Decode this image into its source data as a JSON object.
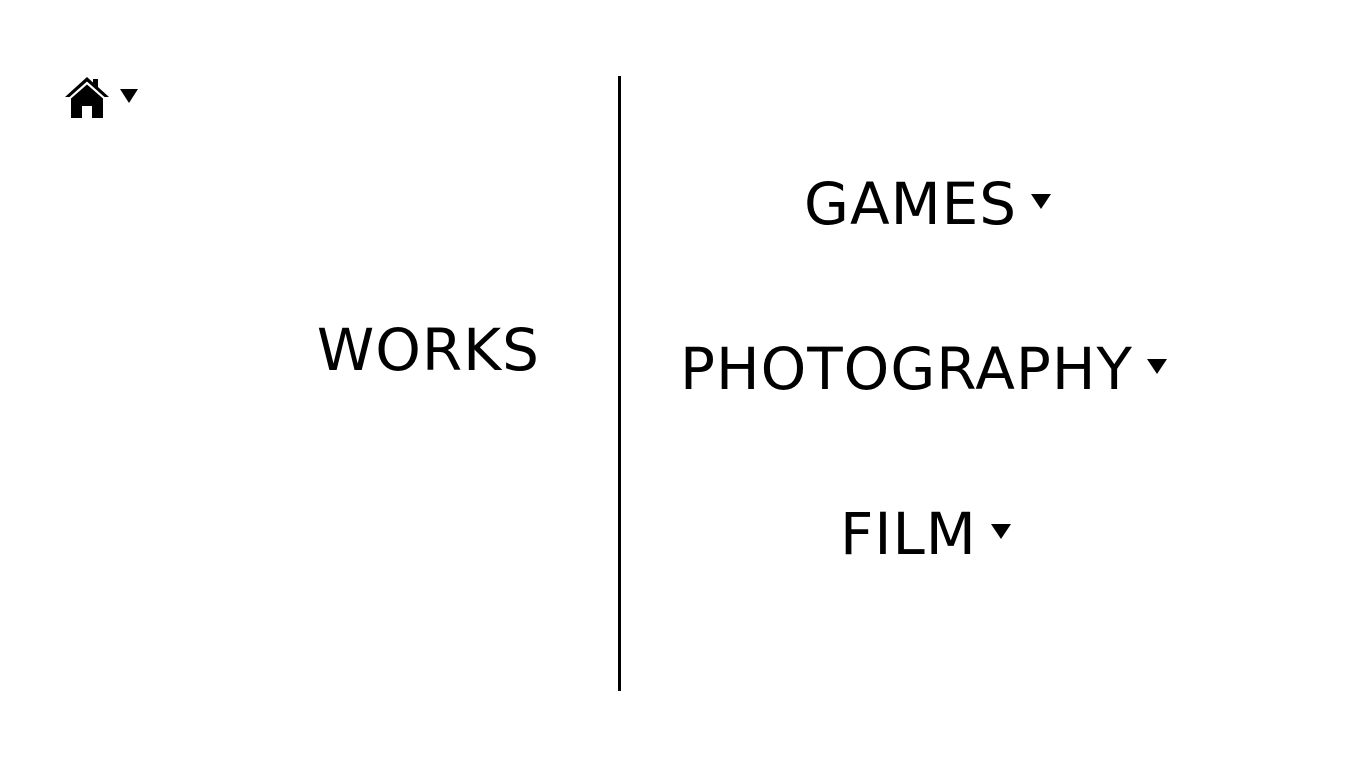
{
  "nav": {
    "home_icon": "home-icon"
  },
  "section": {
    "title": "WORKS"
  },
  "menu": {
    "items": [
      {
        "label": "GAMES"
      },
      {
        "label": "PHOTOGRAPHY"
      },
      {
        "label": "FILM"
      }
    ]
  }
}
